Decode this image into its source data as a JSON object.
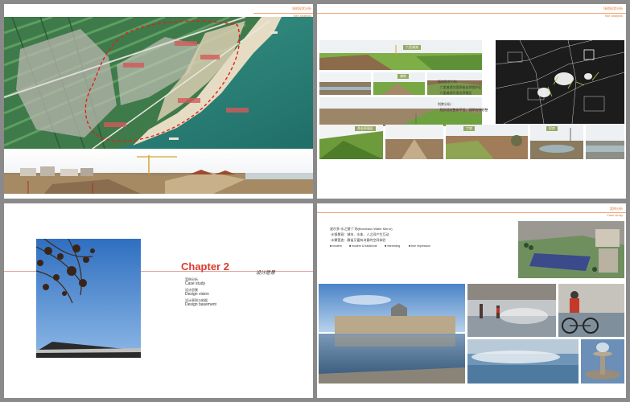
{
  "page1": {
    "header_cn": "场地现状分析",
    "header_en": "Site analysis",
    "labels": [
      " ",
      " ",
      " ",
      " ",
      " "
    ]
  },
  "page2": {
    "header_cn": "场地现状分析",
    "header_en": "Site analysis",
    "captions": [
      "六里滩湖",
      "滩地",
      "渔业养殖区",
      "工地",
      "民房"
    ],
    "notes": "场地现状分析：\n· 六里滩湖为国家级自然保护区\n· 六里滩湖为渔业养殖区\n\n利弊分析：\n· 现状地块整体平坦，湖岸有待修整"
  },
  "page3": {
    "chapter": "Chapter 2",
    "chapter_cn": "设计愿景",
    "items": [
      {
        "cn": "案例分析",
        "en": "Case study"
      },
      {
        "cn": "设计愿景",
        "en": "Design vision"
      },
      {
        "cn": "设计原则与依据",
        "en": "Design basement"
      }
    ]
  },
  "page4": {
    "header_cn": "案例分析",
    "header_en": "Case study",
    "title": "波尔多“水之镜”广场(Bordeaux Water Mirror)",
    "desc_lines": [
      "·水镜景观：城市、水体、人之间产生互动",
      "·水雾营造：静谧又富有诗意的空间体验"
    ],
    "bullets": [
      "modern",
      "modern & traditional",
      "interesting",
      "true impression"
    ]
  }
}
